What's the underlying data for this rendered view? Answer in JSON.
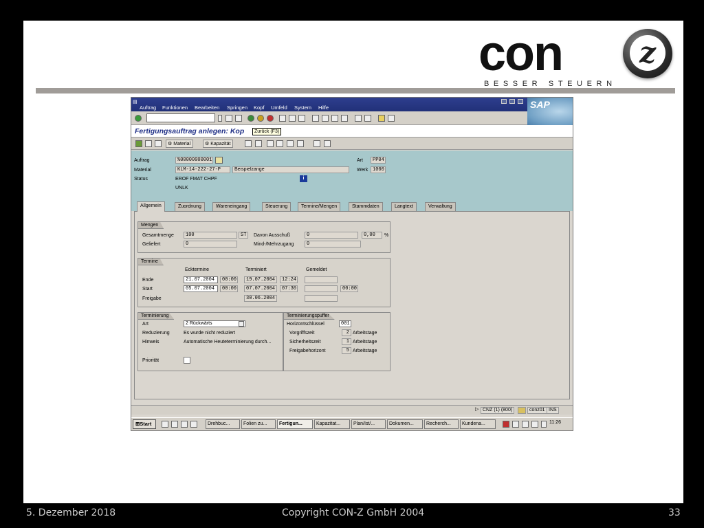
{
  "logo": {
    "text": "con",
    "letter": "z",
    "tagline": "BESSER STEUERN"
  },
  "sap": {
    "menu": [
      "Auftrag",
      "Funktionen",
      "Bearbeiten",
      "Springen",
      "Kopf",
      "Umfeld",
      "System",
      "Hilfe"
    ],
    "brand": "SAP",
    "title": "Fertigungsauftrag anlegen: Kop",
    "tooltip": "Zurück  (F3)",
    "toolbar": {
      "material": "Material",
      "kapazitaet": "Kapazität"
    },
    "header": {
      "auftrag_label": "Auftrag",
      "auftrag_value": "%00000000001",
      "material_label": "Material",
      "material_value": "KLM-14-222-27-P",
      "material_desc": "Beispielzange",
      "status_label": "Status",
      "status_value1": "EROF FMAT CHPF",
      "status_value2": "UNLK",
      "art_label": "Art",
      "art_value": "PP04",
      "werk_label": "Werk",
      "werk_value": "1000"
    },
    "tabs": [
      "Allgemein",
      "Zuordnung",
      "Wareneingang",
      "Steuerung",
      "Termine/Mengen",
      "Stammdaten",
      "Langtext",
      "Verwaltung"
    ],
    "mengen": {
      "title": "Mengen",
      "gesamt_label": "Gesamtmenge",
      "gesamt_value": "100",
      "unit": "ST",
      "ausschuss_label": "Davon Ausschuß",
      "ausschuss_value": "0",
      "pct_value": "0,00",
      "pct_unit": "%",
      "geliefert_label": "Geliefert",
      "geliefert_value": "0",
      "mind_label": "Mind-/Mehrzugang",
      "mind_value": "0"
    },
    "termine": {
      "title": "Termine",
      "col_eck": "Ecktermine",
      "col_term": "Terminiert",
      "col_gem": "Gemeldet",
      "ende_label": "Ende",
      "ende_eck_date": "21.07.2004",
      "ende_eck_time": "00:00",
      "ende_term_date": "19.07.2004",
      "ende_term_time": "12:24",
      "start_label": "Start",
      "start_eck_date": "05.07.2004",
      "start_eck_time": "00:00",
      "start_term_date": "07.07.2004",
      "start_term_time": "07:30",
      "start_gem_time": "00:00",
      "freigabe_label": "Freigabe",
      "freigabe_term_date": "30.06.2004"
    },
    "terminierung": {
      "title": "Terminierung",
      "art_label": "Art",
      "art_value": "2 Rückwärts",
      "reduzierung_label": "Reduzierung",
      "reduzierung_value": "Es wurde nicht reduziert",
      "hinweis_label": "Hinweis",
      "hinweis_value": "Automatische Heuteterminierung durch...",
      "prioritaet_label": "Priorität"
    },
    "puffer": {
      "title": "Terminierungspuffer",
      "horizont_label": "Horizontschlüssel",
      "horizont_value": "001",
      "vorgriff_label": "Vorgriffszeit",
      "vorgriff_value": "2",
      "sicherheit_label": "Sicherheitszeit",
      "sicherheit_value": "1",
      "freigabe_label": "Freigabehorizont",
      "freigabe_value": "5",
      "unit": "Arbeitstage"
    },
    "status": {
      "system": "CNZ (1) (800)",
      "server": "conz01",
      "mode": "INS"
    },
    "taskbar": {
      "start": "Start",
      "tasks": [
        "Drehbuc...",
        "Folien zu...",
        "Fertigun...",
        "Kapazitat...",
        "Plan/Ist/...",
        "Dokumen...",
        "Recherch...",
        "Kundena..."
      ],
      "clock": "11:26"
    }
  },
  "footer": {
    "date": "5. Dezember 2018",
    "copyright": "Copyright CON-Z GmbH 2004",
    "page": "33"
  }
}
